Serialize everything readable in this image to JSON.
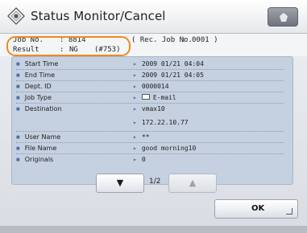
{
  "header": {
    "title": "Status Monitor/Cancel"
  },
  "job_info": {
    "job_no_label": "Job No.",
    "job_no_value": ": 8814",
    "rec_no_label": "( Rec. Job No.",
    "rec_no_colon": ":",
    "rec_no_value": "0001 )",
    "result_label": "Result",
    "result_colon": ":",
    "result_value": "NG",
    "result_code": "(#753)"
  },
  "details": {
    "rows": [
      {
        "label": "Start Time",
        "value": "2009 01/21 04:04"
      },
      {
        "label": "End Time",
        "value": "2009 01/21 04:05"
      },
      {
        "label": "Dept. ID",
        "value": "0000014"
      },
      {
        "label": "Job Type",
        "value": "E-mail"
      },
      {
        "label": "Destination",
        "value": "vmax10"
      },
      {
        "label": "",
        "value": "172.22.10.77"
      },
      {
        "label": "User Name",
        "value": "**"
      },
      {
        "label": "File Name",
        "value": "good morning10"
      },
      {
        "label": "Originals",
        "value": "0"
      }
    ]
  },
  "pager": {
    "page_indicator": "1/2",
    "down_glyph": "▼",
    "up_glyph": "▲"
  },
  "footer": {
    "ok_label": "OK"
  },
  "colors": {
    "highlight": "#f08a1a",
    "panel": "#c5d0e0"
  }
}
